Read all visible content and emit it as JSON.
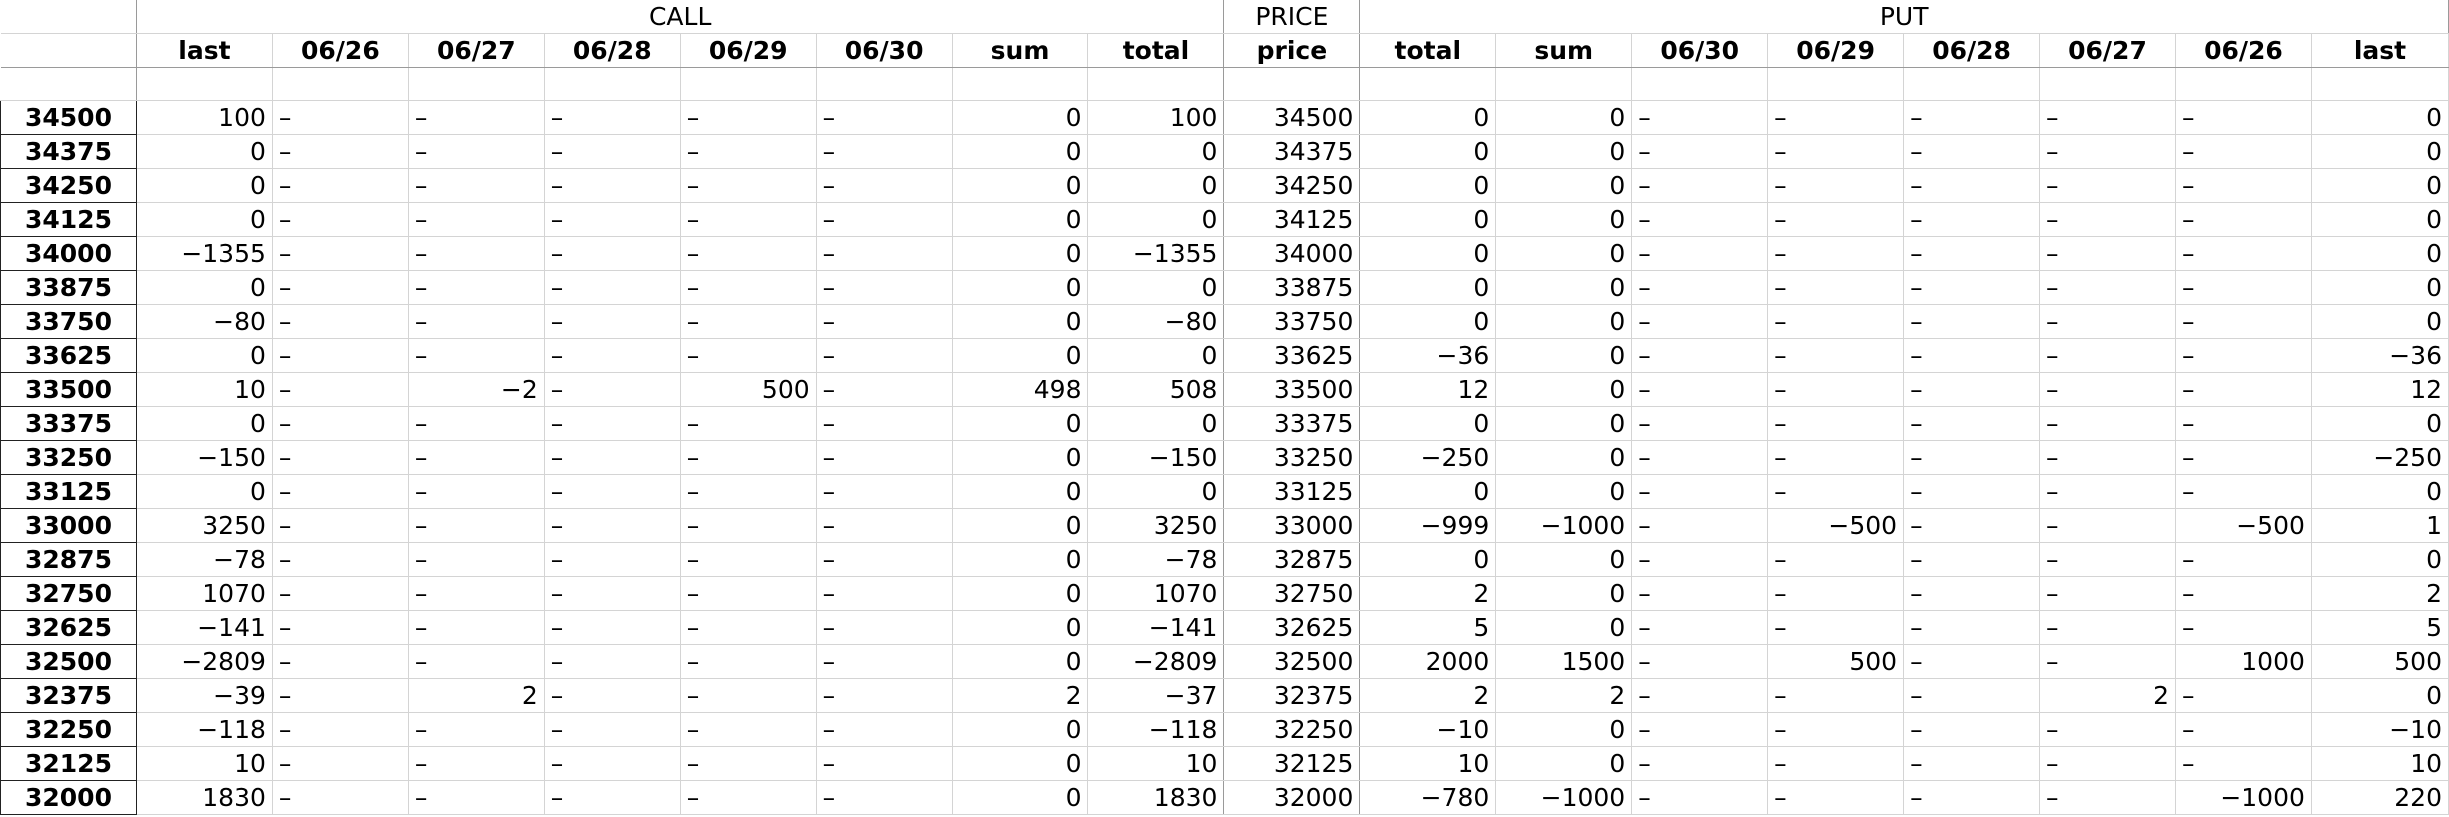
{
  "header": {
    "group_row": {
      "blank": "",
      "call": "CALL",
      "price": "PRICE",
      "put": "PUT"
    },
    "columns": [
      "",
      "last",
      "06/26",
      "06/27",
      "06/28",
      "06/29",
      "06/30",
      "sum",
      "total",
      "price",
      "total",
      "sum",
      "06/30",
      "06/29",
      "06/28",
      "06/27",
      "06/26",
      "last"
    ]
  },
  "rows": [
    [
      "34500",
      "100",
      "–",
      "–",
      "–",
      "–",
      "–",
      "0",
      "100",
      "34500",
      "0",
      "0",
      "–",
      "–",
      "–",
      "–",
      "–",
      "0"
    ],
    [
      "34375",
      "0",
      "–",
      "–",
      "–",
      "–",
      "–",
      "0",
      "0",
      "34375",
      "0",
      "0",
      "–",
      "–",
      "–",
      "–",
      "–",
      "0"
    ],
    [
      "34250",
      "0",
      "–",
      "–",
      "–",
      "–",
      "–",
      "0",
      "0",
      "34250",
      "0",
      "0",
      "–",
      "–",
      "–",
      "–",
      "–",
      "0"
    ],
    [
      "34125",
      "0",
      "–",
      "–",
      "–",
      "–",
      "–",
      "0",
      "0",
      "34125",
      "0",
      "0",
      "–",
      "–",
      "–",
      "–",
      "–",
      "0"
    ],
    [
      "34000",
      "−1355",
      "–",
      "–",
      "–",
      "–",
      "–",
      "0",
      "−1355",
      "34000",
      "0",
      "0",
      "–",
      "–",
      "–",
      "–",
      "–",
      "0"
    ],
    [
      "33875",
      "0",
      "–",
      "–",
      "–",
      "–",
      "–",
      "0",
      "0",
      "33875",
      "0",
      "0",
      "–",
      "–",
      "–",
      "–",
      "–",
      "0"
    ],
    [
      "33750",
      "−80",
      "–",
      "–",
      "–",
      "–",
      "–",
      "0",
      "−80",
      "33750",
      "0",
      "0",
      "–",
      "–",
      "–",
      "–",
      "–",
      "0"
    ],
    [
      "33625",
      "0",
      "–",
      "–",
      "–",
      "–",
      "–",
      "0",
      "0",
      "33625",
      "−36",
      "0",
      "–",
      "–",
      "–",
      "–",
      "–",
      "−36"
    ],
    [
      "33500",
      "10",
      "–",
      "−2",
      "–",
      "500",
      "–",
      "498",
      "508",
      "33500",
      "12",
      "0",
      "–",
      "–",
      "–",
      "–",
      "–",
      "12"
    ],
    [
      "33375",
      "0",
      "–",
      "–",
      "–",
      "–",
      "–",
      "0",
      "0",
      "33375",
      "0",
      "0",
      "–",
      "–",
      "–",
      "–",
      "–",
      "0"
    ],
    [
      "33250",
      "−150",
      "–",
      "–",
      "–",
      "–",
      "–",
      "0",
      "−150",
      "33250",
      "−250",
      "0",
      "–",
      "–",
      "–",
      "–",
      "–",
      "−250"
    ],
    [
      "33125",
      "0",
      "–",
      "–",
      "–",
      "–",
      "–",
      "0",
      "0",
      "33125",
      "0",
      "0",
      "–",
      "–",
      "–",
      "–",
      "–",
      "0"
    ],
    [
      "33000",
      "3250",
      "–",
      "–",
      "–",
      "–",
      "–",
      "0",
      "3250",
      "33000",
      "−999",
      "−1000",
      "–",
      "−500",
      "–",
      "–",
      "−500",
      "1"
    ],
    [
      "32875",
      "−78",
      "–",
      "–",
      "–",
      "–",
      "–",
      "0",
      "−78",
      "32875",
      "0",
      "0",
      "–",
      "–",
      "–",
      "–",
      "–",
      "0"
    ],
    [
      "32750",
      "1070",
      "–",
      "–",
      "–",
      "–",
      "–",
      "0",
      "1070",
      "32750",
      "2",
      "0",
      "–",
      "–",
      "–",
      "–",
      "–",
      "2"
    ],
    [
      "32625",
      "−141",
      "–",
      "–",
      "–",
      "–",
      "–",
      "0",
      "−141",
      "32625",
      "5",
      "0",
      "–",
      "–",
      "–",
      "–",
      "–",
      "5"
    ],
    [
      "32500",
      "−2809",
      "–",
      "–",
      "–",
      "–",
      "–",
      "0",
      "−2809",
      "32500",
      "2000",
      "1500",
      "–",
      "500",
      "–",
      "–",
      "1000",
      "500"
    ],
    [
      "32375",
      "−39",
      "–",
      "2",
      "–",
      "–",
      "–",
      "2",
      "−37",
      "32375",
      "2",
      "2",
      "–",
      "–",
      "–",
      "2",
      "–",
      "0"
    ],
    [
      "32250",
      "−118",
      "–",
      "–",
      "–",
      "–",
      "–",
      "0",
      "−118",
      "32250",
      "−10",
      "0",
      "–",
      "–",
      "–",
      "–",
      "–",
      "−10"
    ],
    [
      "32125",
      "10",
      "–",
      "–",
      "–",
      "–",
      "–",
      "0",
      "10",
      "32125",
      "10",
      "0",
      "–",
      "–",
      "–",
      "–",
      "–",
      "10"
    ],
    [
      "32000",
      "1830",
      "–",
      "–",
      "–",
      "–",
      "–",
      "0",
      "1830",
      "32000",
      "−780",
      "−1000",
      "–",
      "–",
      "–",
      "–",
      "−1000",
      "220"
    ]
  ]
}
